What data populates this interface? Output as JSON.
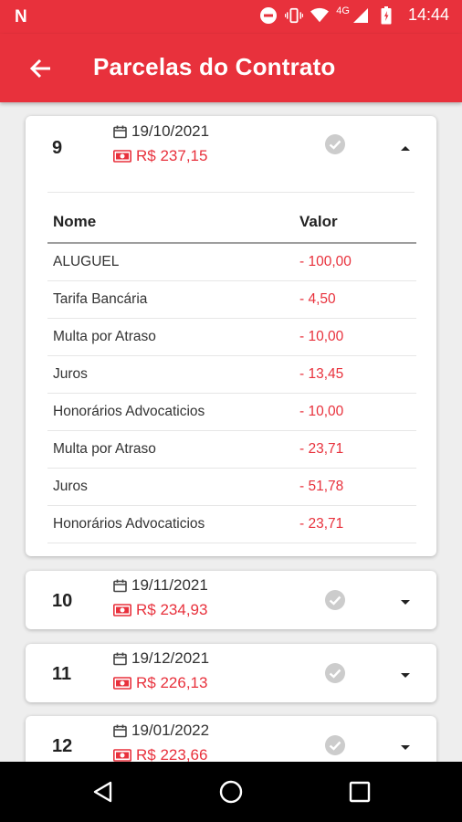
{
  "status_bar": {
    "time": "14:44",
    "network": "4G",
    "left_icon": "n-notification-icon"
  },
  "app_bar": {
    "title": "Parcelas do Contrato",
    "back_icon": "arrow-back-icon"
  },
  "colors": {
    "primary": "#e8313c",
    "paid_check": "#cccccc"
  },
  "installments": [
    {
      "number": "9",
      "date": "19/10/2021",
      "amount": "R$ 237,15",
      "expanded": true,
      "table": {
        "headers": {
          "name": "Nome",
          "value": "Valor"
        },
        "rows": [
          {
            "name": "ALUGUEL",
            "value": "- 100,00"
          },
          {
            "name": "Tarifa Bancária",
            "value": "- 4,50"
          },
          {
            "name": "Multa por Atraso",
            "value": "- 10,00"
          },
          {
            "name": "Juros",
            "value": "- 13,45"
          },
          {
            "name": "Honorários Advocaticios",
            "value": "- 10,00"
          },
          {
            "name": "Multa por Atraso",
            "value": "- 23,71"
          },
          {
            "name": "Juros",
            "value": "- 51,78"
          },
          {
            "name": "Honorários Advocaticios",
            "value": "- 23,71"
          }
        ]
      }
    },
    {
      "number": "10",
      "date": "19/11/2021",
      "amount": "R$ 234,93",
      "expanded": false
    },
    {
      "number": "11",
      "date": "19/12/2021",
      "amount": "R$ 226,13",
      "expanded": false
    },
    {
      "number": "12",
      "date": "19/01/2022",
      "amount": "R$ 223,66",
      "expanded": false
    }
  ],
  "nav_bar": {
    "buttons": [
      "back-triangle-icon",
      "home-circle-icon",
      "recents-square-icon"
    ]
  }
}
